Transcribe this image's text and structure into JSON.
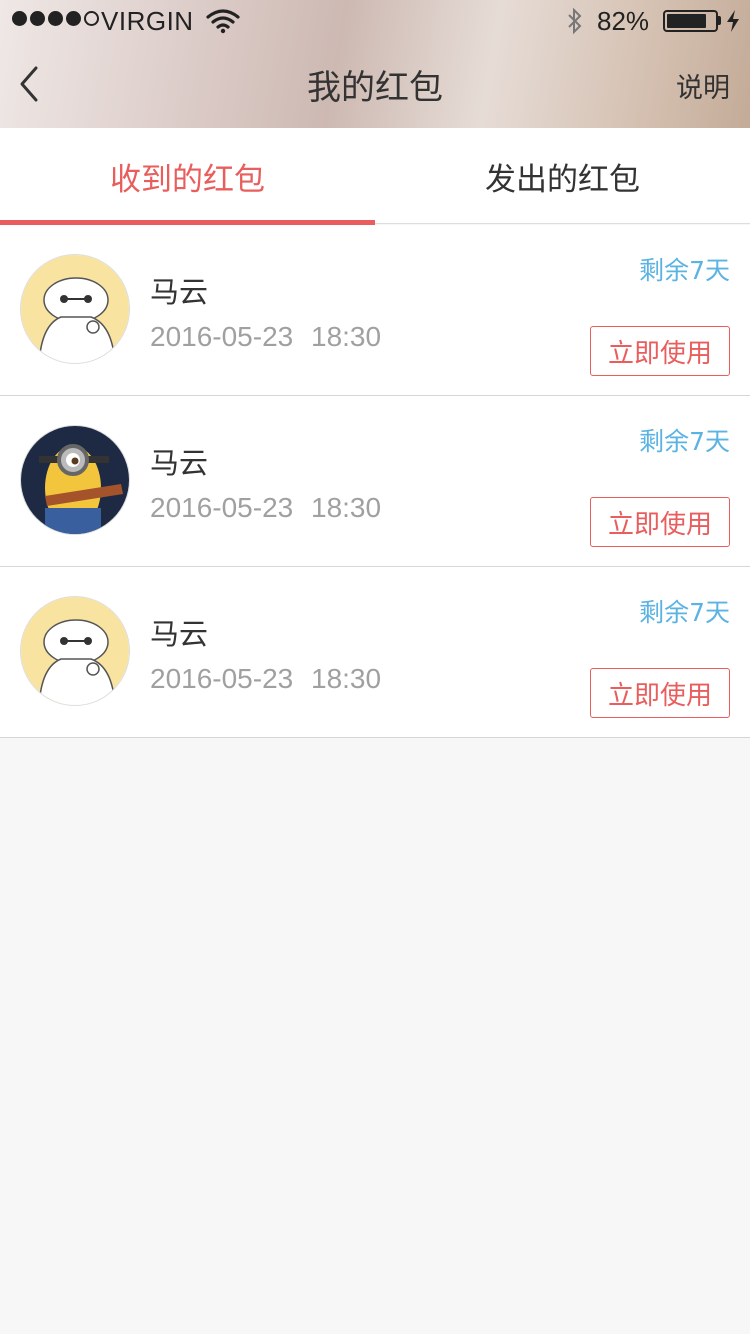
{
  "status_bar": {
    "carrier": "VIRGIN",
    "battery_percent": "82%",
    "battery_level": 0.82,
    "signal_bars_filled": 4,
    "signal_bars_total": 5
  },
  "nav": {
    "title": "我的红包",
    "right_link": "说明",
    "back_icon": "chevron-left-icon"
  },
  "tabs": [
    {
      "label": "收到的红包",
      "active": true
    },
    {
      "label": "发出的红包",
      "active": false
    }
  ],
  "envelopes": [
    {
      "name": "马云",
      "time": "2016-05-23 18:30",
      "remaining": "剩余7天",
      "action": "立即使用",
      "avatar": "baymax-avatar"
    },
    {
      "name": "马云",
      "time": "2016-05-23 18:30",
      "remaining": "剩余7天",
      "action": "立即使用",
      "avatar": "minion-avatar"
    },
    {
      "name": "马云",
      "time": "2016-05-23 18:30",
      "remaining": "剩余7天",
      "action": "立即使用",
      "avatar": "baymax-avatar"
    }
  ],
  "colors": {
    "accent": "#e95d5d",
    "remaining_text": "#5bb3e3",
    "secondary_text": "#a0a0a0",
    "page_background": "#f7f7f7"
  }
}
